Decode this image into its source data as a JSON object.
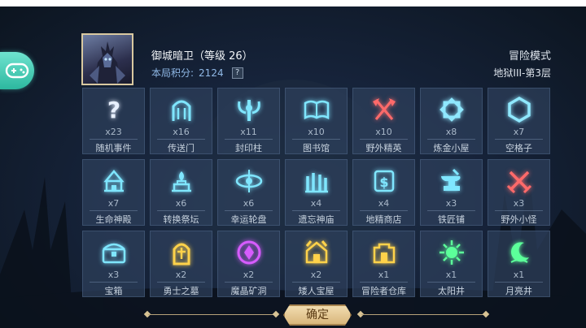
{
  "header": {
    "player_name": "御城暗卫（等级 26）",
    "score_label": "本局积分:",
    "score_value": "2124",
    "help_label": "?",
    "mode": "冒险模式",
    "floor": "地狱III-第3层"
  },
  "colors": {
    "accent_teal": "#2db89f",
    "cell_bg": "#2e405c",
    "confirm_bg": "#e6c894"
  },
  "tiles": [
    {
      "name": "随机事件",
      "count": "x23",
      "icon": "question-icon",
      "color": "#e8f0ff"
    },
    {
      "name": "传送门",
      "count": "x16",
      "icon": "portal-icon",
      "color": "#7fe6ff"
    },
    {
      "name": "封印柱",
      "count": "x11",
      "icon": "seal-pillar-icon",
      "color": "#7fe6ff"
    },
    {
      "name": "图书馆",
      "count": "x10",
      "icon": "book-icon",
      "color": "#7fe6ff"
    },
    {
      "name": "野外精英",
      "count": "x10",
      "icon": "crossed-axes-icon",
      "color": "#ff6a6a"
    },
    {
      "name": "炼金小屋",
      "count": "x8",
      "icon": "alchemy-star-icon",
      "color": "#8fe8ff"
    },
    {
      "name": "空格子",
      "count": "x7",
      "icon": "hexagon-icon",
      "color": "#8fe8ff"
    },
    {
      "name": "生命神殿",
      "count": "x7",
      "icon": "temple-icon",
      "color": "#7fe6ff"
    },
    {
      "name": "转换祭坛",
      "count": "x6",
      "icon": "altar-icon",
      "color": "#7fe6ff"
    },
    {
      "name": "幸运轮盘",
      "count": "x6",
      "icon": "wheel-icon",
      "color": "#7fe6ff"
    },
    {
      "name": "遗忘神庙",
      "count": "x4",
      "icon": "ruins-icon",
      "color": "#7fe6ff"
    },
    {
      "name": "地精商店",
      "count": "x4",
      "icon": "shop-icon",
      "color": "#7fe6ff"
    },
    {
      "name": "铁匠铺",
      "count": "x3",
      "icon": "anvil-icon",
      "color": "#7fe6ff"
    },
    {
      "name": "野外小怪",
      "count": "x3",
      "icon": "crossed-swords-icon",
      "color": "#ff6a6a"
    },
    {
      "name": "宝箱",
      "count": "x3",
      "icon": "chest-icon",
      "color": "#7fe6ff"
    },
    {
      "name": "勇士之墓",
      "count": "x2",
      "icon": "tomb-icon",
      "color": "#ffd24a"
    },
    {
      "name": "魔晶矿洞",
      "count": "x2",
      "icon": "crystal-cave-icon",
      "color": "#d75cff"
    },
    {
      "name": "矮人宝屋",
      "count": "x2",
      "icon": "dwarf-house-icon",
      "color": "#ffd24a"
    },
    {
      "name": "冒险者仓库",
      "count": "x1",
      "icon": "warehouse-icon",
      "color": "#ffd24a"
    },
    {
      "name": "太阳井",
      "count": "x1",
      "icon": "sun-icon",
      "color": "#5cff9a"
    },
    {
      "name": "月亮井",
      "count": "x1",
      "icon": "moon-icon",
      "color": "#5cff9a"
    }
  ],
  "confirm_label": "确定"
}
